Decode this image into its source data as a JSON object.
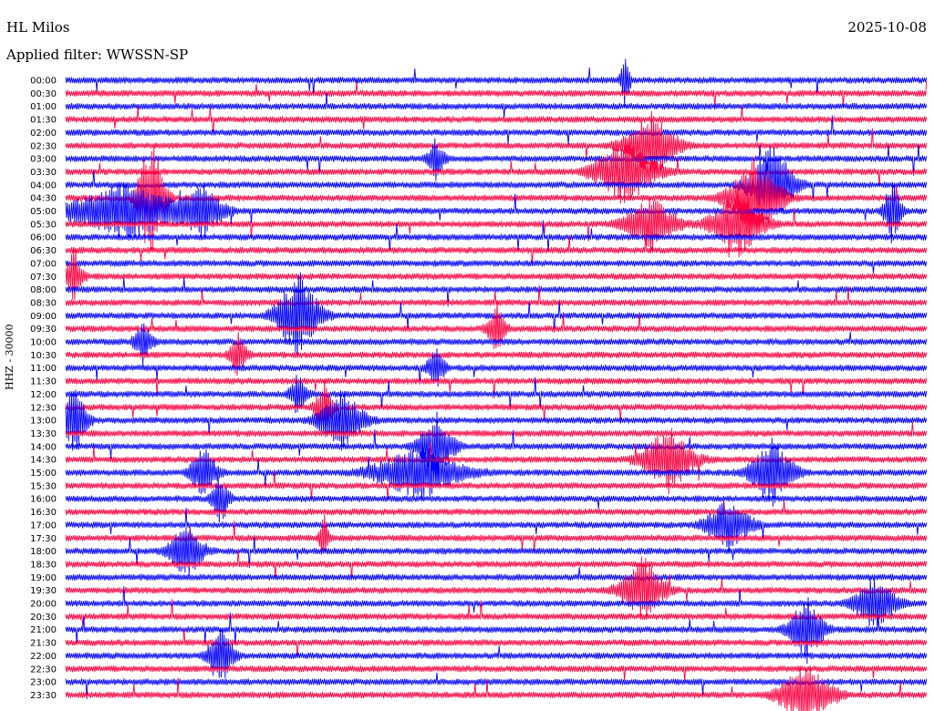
{
  "header": {
    "station": "HL Milos",
    "filter": "Applied filter: WWSSN-SP",
    "date": "2025-10-08"
  },
  "channel_label": "HHZ - 30000",
  "chart_data": {
    "type": "helicorder",
    "time_labels": [
      "00:00",
      "00:30",
      "01:00",
      "01:30",
      "02:00",
      "02:30",
      "03:00",
      "03:30",
      "04:00",
      "04:30",
      "05:00",
      "05:30",
      "06:00",
      "06:30",
      "07:00",
      "07:30",
      "08:00",
      "08:30",
      "09:00",
      "09:30",
      "10:00",
      "10:30",
      "11:00",
      "11:30",
      "12:00",
      "12:30",
      "13:00",
      "13:30",
      "14:00",
      "14:30",
      "15:00",
      "15:30",
      "16:00",
      "16:30",
      "17:00",
      "17:30",
      "18:00",
      "18:30",
      "19:00",
      "19:30",
      "20:00",
      "20:30",
      "21:00",
      "21:30",
      "22:00",
      "22:30",
      "23:00",
      "23:30"
    ],
    "colors": [
      "#0000ff",
      "#ff0040"
    ],
    "background": "#ffffff",
    "events": [
      {
        "row": 0,
        "t": 0.65,
        "amp": 3,
        "dur": 0.01
      },
      {
        "row": 5,
        "t": 0.68,
        "amp": 3,
        "dur": 0.06
      },
      {
        "row": 6,
        "t": 0.43,
        "amp": 2,
        "dur": 0.02
      },
      {
        "row": 7,
        "t": 0.65,
        "amp": 3,
        "dur": 0.07
      },
      {
        "row": 8,
        "t": 0.82,
        "amp": 4,
        "dur": 0.05
      },
      {
        "row": 9,
        "t": 0.1,
        "amp": 7,
        "dur": 0.03
      },
      {
        "row": 9,
        "t": 0.8,
        "amp": 4,
        "dur": 0.06
      },
      {
        "row": 10,
        "t": 0.07,
        "amp": 2.5,
        "dur": 0.14
      },
      {
        "row": 10,
        "t": 0.16,
        "amp": 2,
        "dur": 0.05
      },
      {
        "row": 10,
        "t": 0.96,
        "amp": 3,
        "dur": 0.02
      },
      {
        "row": 11,
        "t": 0.68,
        "amp": 2.5,
        "dur": 0.06
      },
      {
        "row": 11,
        "t": 0.78,
        "amp": 3,
        "dur": 0.06
      },
      {
        "row": 15,
        "t": 0.01,
        "amp": 2.5,
        "dur": 0.02
      },
      {
        "row": 18,
        "t": 0.27,
        "amp": 4,
        "dur": 0.05
      },
      {
        "row": 19,
        "t": 0.5,
        "amp": 2.5,
        "dur": 0.02
      },
      {
        "row": 20,
        "t": 0.09,
        "amp": 2,
        "dur": 0.02
      },
      {
        "row": 21,
        "t": 0.2,
        "amp": 2,
        "dur": 0.02
      },
      {
        "row": 22,
        "t": 0.43,
        "amp": 2,
        "dur": 0.02
      },
      {
        "row": 24,
        "t": 0.27,
        "amp": 2,
        "dur": 0.02
      },
      {
        "row": 25,
        "t": 0.3,
        "amp": 2.5,
        "dur": 0.02
      },
      {
        "row": 26,
        "t": 0.01,
        "amp": 3,
        "dur": 0.03
      },
      {
        "row": 26,
        "t": 0.32,
        "amp": 3,
        "dur": 0.05
      },
      {
        "row": 28,
        "t": 0.43,
        "amp": 3,
        "dur": 0.04
      },
      {
        "row": 29,
        "t": 0.7,
        "amp": 3,
        "dur": 0.06
      },
      {
        "row": 30,
        "t": 0.41,
        "amp": 2.5,
        "dur": 0.1
      },
      {
        "row": 30,
        "t": 0.16,
        "amp": 2.5,
        "dur": 0.03
      },
      {
        "row": 30,
        "t": 0.82,
        "amp": 3,
        "dur": 0.05
      },
      {
        "row": 32,
        "t": 0.18,
        "amp": 2.5,
        "dur": 0.02
      },
      {
        "row": 34,
        "t": 0.77,
        "amp": 2.5,
        "dur": 0.05
      },
      {
        "row": 35,
        "t": 0.3,
        "amp": 2.5,
        "dur": 0.01
      },
      {
        "row": 36,
        "t": 0.14,
        "amp": 2.5,
        "dur": 0.04
      },
      {
        "row": 39,
        "t": 0.67,
        "amp": 3,
        "dur": 0.05
      },
      {
        "row": 40,
        "t": 0.94,
        "amp": 2.5,
        "dur": 0.05
      },
      {
        "row": 42,
        "t": 0.86,
        "amp": 3,
        "dur": 0.04
      },
      {
        "row": 44,
        "t": 0.18,
        "amp": 3,
        "dur": 0.03
      },
      {
        "row": 47,
        "t": 0.86,
        "amp": 3,
        "dur": 0.06
      }
    ]
  }
}
